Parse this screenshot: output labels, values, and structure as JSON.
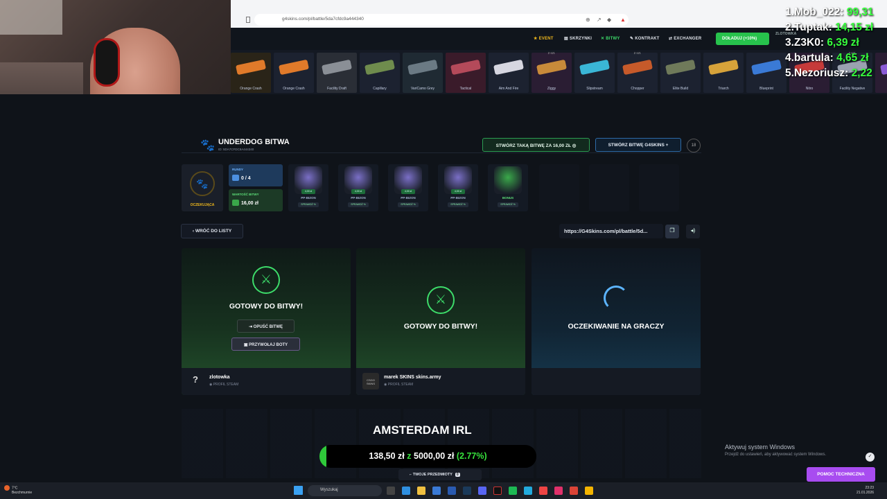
{
  "browser": {
    "url": "g4skins.com/pl/battle/5da7cfdc9a444340"
  },
  "nav": {
    "items": [
      {
        "label": "EVENT",
        "icon": "star-icon"
      },
      {
        "label": "SKRZYNKI",
        "icon": "box-icon"
      },
      {
        "label": "BITWY",
        "icon": "swords-icon"
      },
      {
        "label": "KONTRAKT",
        "icon": "pen-icon"
      },
      {
        "label": "EXCHANGER",
        "icon": "exchange-icon"
      }
    ],
    "topup_label": "DOŁADUJ (+10%)",
    "user_name": "ZLOTOWKA"
  },
  "drops": [
    {
      "name": "Orange Crash",
      "color": "#e07a2a",
      "bg": "#2a2418",
      "count": ""
    },
    {
      "name": "Orange Crash",
      "color": "#e07a2a",
      "bg": "#1c2230",
      "count": ""
    },
    {
      "name": "Facility Draft",
      "color": "#8a8f96",
      "bg": "#2a2e36",
      "count": ""
    },
    {
      "name": "Capillary",
      "color": "#6f8c4d",
      "bg": "#1c2230",
      "count": ""
    },
    {
      "name": "VariCamo Grey",
      "color": "#6b7a84",
      "bg": "#1f2a33",
      "count": ""
    },
    {
      "name": "Tactical",
      "color": "#b44a5a",
      "bg": "#3a1b2a",
      "count": ""
    },
    {
      "name": "Aim And Fire",
      "color": "#d6d6e0",
      "bg": "#1c2230",
      "count": ""
    },
    {
      "name": "Ziggy",
      "color": "#c88a3a",
      "bg": "#2a1d33",
      "count": "2 szt."
    },
    {
      "name": "Slipstream",
      "color": "#3ab6d6",
      "bg": "#1c2230",
      "count": ""
    },
    {
      "name": "Chopper",
      "color": "#c65a2a",
      "bg": "#1c2230",
      "count": "2 szt."
    },
    {
      "name": "Elite Build",
      "color": "#6f7a5a",
      "bg": "#1c2230",
      "count": ""
    },
    {
      "name": "Triarch",
      "color": "#d6a23a",
      "bg": "#1c2230",
      "count": ""
    },
    {
      "name": "Blueprint",
      "color": "#3a7ad6",
      "bg": "#1c2230",
      "count": ""
    },
    {
      "name": "Nitro",
      "color": "#c63a3a",
      "bg": "#2a1d33",
      "count": ""
    },
    {
      "name": "Facility Negative",
      "color": "#9aa2b0",
      "bg": "#1c2230",
      "count": "2 szt."
    },
    {
      "name": "Ima",
      "color": "#8a5ad6",
      "bg": "#2a1d33",
      "count": ""
    }
  ],
  "battle": {
    "title": "UNDERDOG BITWA",
    "id_text": "ID: 5DA7CFDC9A444340",
    "create_same_label": "STWÓRZ TAKĄ BITWĘ ZA 16,00 ZŁ",
    "create_new_label": "STWÓRZ BITWĘ G4SKINS",
    "age_badge": "18",
    "status_label": "OCZEKUJĄCA",
    "rounds_label": "RUNDY",
    "rounds_value": "0 / 4",
    "value_label": "WARTOŚĆ BITWY",
    "value_value": "16,00 zł",
    "cases": [
      {
        "name": "PP-BIZON",
        "price": "4,00 zł",
        "check": "SPRAWDŹ %",
        "color": "#7a6fc6"
      },
      {
        "name": "PP-BIZON",
        "price": "4,00 zł",
        "check": "SPRAWDŹ %",
        "color": "#7a6fc6"
      },
      {
        "name": "PP-BIZON",
        "price": "4,00 zł",
        "check": "SPRAWDŹ %",
        "color": "#7a6fc6"
      },
      {
        "name": "PP-BIZON",
        "price": "4,00 zł",
        "check": "SPRAWDŹ %",
        "color": "#7a6fc6"
      },
      {
        "name": "BONUS",
        "price": "",
        "check": "SPRAWDŹ %",
        "color": "#3aa84a"
      }
    ],
    "back_label": "WRÓĆ DO LISTY",
    "share_url": "https://G4Skins.com/pl/battle/5d..."
  },
  "slots": [
    {
      "status": "GOTOWY DO BITWY!",
      "leave_label": "OPUŚĆ BITWĘ",
      "bots_label": "PRZYWOŁAJ BOTY",
      "player": "zlotowka",
      "profile": "PROFIL STEAM",
      "avatar": "?"
    },
    {
      "status": "GOTOWY DO BITWY!",
      "player": "marek SKINS skins.army",
      "profile": "PROFIL STEAM",
      "avatar": "CSGO SKINS"
    },
    {
      "status": "OCZEKIWANIE NA GRACZY"
    }
  ],
  "leaderboard": [
    {
      "name": "1.Mob_022:",
      "amount": "99,31"
    },
    {
      "name": "2.Tuptak:",
      "amount": "14,15 zł"
    },
    {
      "name": "3.Z3K0:",
      "amount": "6,39 zł"
    },
    {
      "name": "4.bartula:",
      "amount": "4,65 zł"
    },
    {
      "name": "5.Nezoriusz:",
      "amount": "2,22"
    }
  ],
  "goal": {
    "title": "AMSTERDAM IRL",
    "current": "138,50 zł",
    "sep": "z",
    "target": "5000,00 zł",
    "percent_text": "(2.77%)",
    "fraction": 0.0277
  },
  "footer": {
    "my_items_label": "TWOJE PRZEDMIOTY",
    "my_items_count": "0",
    "support_label": "POMOC TECHNICZNA"
  },
  "windows": {
    "activate_title": "Aktywuj system Windows",
    "activate_sub": "Przejdź do ustawień, aby aktywować system Windows.",
    "weather_temp": "7°C",
    "weather_desc": "Bezchmurnie",
    "search_placeholder": "Wyszukaj",
    "time": "23:23",
    "date": "21.01.2026"
  },
  "colors": {
    "accent_green": "#3ddc6a",
    "brand_gold": "#f0b91c",
    "support_purple": "#a84cf0"
  }
}
